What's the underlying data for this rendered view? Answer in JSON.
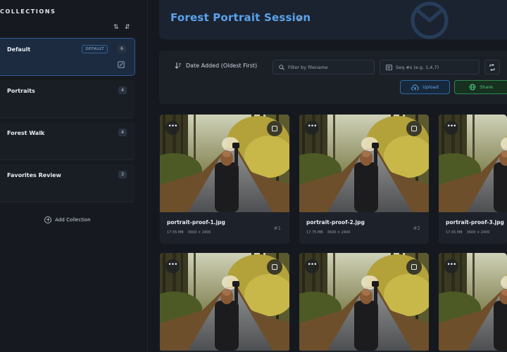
{
  "sidebar": {
    "heading": "COLLECTIONS",
    "add_label": "Add Collection",
    "collections": [
      {
        "name": "Default",
        "badge": "DEFAULT",
        "count": "6"
      },
      {
        "name": "Portraits",
        "count": "4"
      },
      {
        "name": "Forest Walk",
        "count": "4"
      },
      {
        "name": "Favorites Review",
        "count": "3"
      }
    ]
  },
  "header": {
    "title": "Forest Portrait Session"
  },
  "toolbar": {
    "sort_label": "Date Added (Oldest First)",
    "filter_placeholder": "Filter by filename",
    "seq_placeholder": "Seq #s (e.g. 1,4,7)",
    "upload_label": "Upload",
    "share_label": "Share"
  },
  "photos": [
    {
      "filename": "portrait-proof-1.jpg",
      "size": "17.55 MB",
      "dims": "3600 × 2400",
      "seq": "#1"
    },
    {
      "filename": "portrait-proof-2.jpg",
      "size": "17.75 MB",
      "dims": "3600 × 2400",
      "seq": "#2"
    },
    {
      "filename": "portrait-proof-3.jpg",
      "size": "17.95 MB",
      "dims": "3600 × 2400",
      "seq": ""
    }
  ],
  "colors": {
    "accent": "#5aa2ec",
    "share": "#4fc781",
    "background": "#15191f"
  },
  "icons": {
    "sort": "sort-icon",
    "filter": "search-icon",
    "seq": "list-icon",
    "upload": "cloud-upload-icon",
    "share": "globe-icon",
    "menu": "more-horizontal-icon",
    "select": "checkbox-icon",
    "edit": "pencil-icon",
    "add": "plus-circle-icon"
  }
}
